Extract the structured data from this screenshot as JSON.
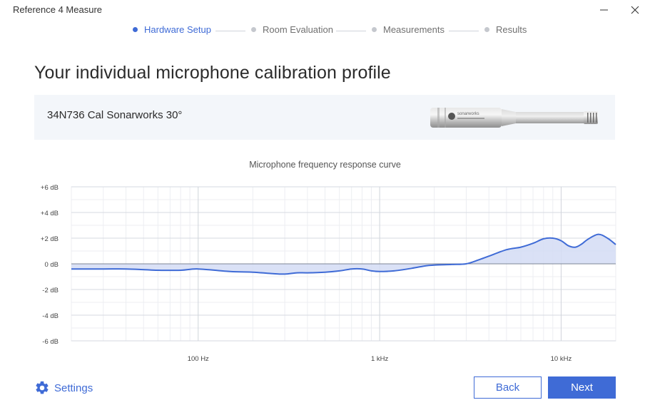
{
  "window": {
    "title": "Reference 4 Measure"
  },
  "stepper": {
    "steps": [
      {
        "label": "Hardware Setup",
        "active": true
      },
      {
        "label": "Room Evaluation",
        "active": false
      },
      {
        "label": "Measurements",
        "active": false
      },
      {
        "label": "Results",
        "active": false
      }
    ]
  },
  "page": {
    "title": "Your individual microphone calibration profile"
  },
  "microphone": {
    "name": "34N736 Cal Sonarworks 30°",
    "brand_text": "sonarworks"
  },
  "chart_data": {
    "type": "area",
    "title": "Microphone frequency response curve",
    "xscale": "log",
    "xlim": [
      20,
      20000
    ],
    "ylim": [
      -6,
      6
    ],
    "x_ticks": [
      {
        "value": 100,
        "label": "100 Hz"
      },
      {
        "value": 1000,
        "label": "1 kHz"
      },
      {
        "value": 10000,
        "label": "10 kHz"
      }
    ],
    "y_ticks": [
      {
        "value": 6,
        "label": "+6 dB"
      },
      {
        "value": 4,
        "label": "+4 dB"
      },
      {
        "value": 2,
        "label": "+2 dB"
      },
      {
        "value": 0,
        "label": "0 dB"
      },
      {
        "value": -2,
        "label": "-2 dB"
      },
      {
        "value": -4,
        "label": "-4 dB"
      },
      {
        "value": -6,
        "label": "-6 dB"
      }
    ],
    "grid": true,
    "line_color": "#3f6bd6",
    "fill_color": "#d3dcf5",
    "series": [
      {
        "x": [
          20,
          30,
          40,
          50,
          60,
          80,
          100,
          150,
          200,
          250,
          300,
          350,
          400,
          500,
          600,
          700,
          800,
          900,
          1000,
          1200,
          1500,
          1800,
          2000,
          2500,
          3000,
          3500,
          4000,
          5000,
          6000,
          7000,
          8000,
          9000,
          10000,
          11000,
          12000,
          13000,
          14000,
          16000,
          18000,
          20000
        ],
        "y": [
          -0.4,
          -0.4,
          -0.4,
          -0.45,
          -0.5,
          -0.5,
          -0.4,
          -0.6,
          -0.65,
          -0.75,
          -0.8,
          -0.7,
          -0.7,
          -0.65,
          -0.55,
          -0.4,
          -0.4,
          -0.55,
          -0.6,
          -0.55,
          -0.35,
          -0.15,
          -0.1,
          -0.05,
          0.0,
          0.3,
          0.6,
          1.1,
          1.3,
          1.6,
          1.95,
          2.0,
          1.8,
          1.4,
          1.3,
          1.55,
          1.9,
          2.3,
          2.0,
          1.5
        ]
      }
    ]
  },
  "footer": {
    "settings_label": "Settings",
    "back_label": "Back",
    "next_label": "Next"
  },
  "colors": {
    "accent": "#3f6bd6",
    "panel_bg": "#f3f6fa",
    "inactive_dot": "#c5c8ce"
  }
}
